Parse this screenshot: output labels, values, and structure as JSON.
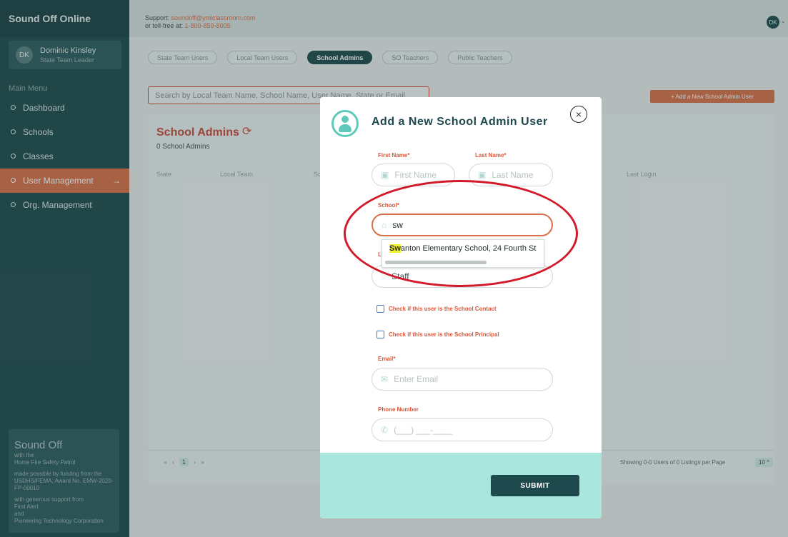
{
  "app": {
    "brand": "Sound Off Online"
  },
  "user": {
    "initials": "DK",
    "name": "Dominic Kinsley",
    "role": "State Team Leader"
  },
  "sidebar": {
    "menu_title": "Main Menu",
    "items": [
      {
        "label": "Dashboard"
      },
      {
        "label": "Schools"
      },
      {
        "label": "Classes"
      },
      {
        "label": "User Management",
        "arrow": "→"
      },
      {
        "label": "Org. Management"
      }
    ],
    "promo": {
      "title": "Sound Off",
      "line1": "with the",
      "line2": "Home Fire Safety Patrol",
      "funding": "made possible by funding from the USDHS/FEMA, Award No. EMW-2020-FP-00010",
      "support": "with generous support from",
      "s1": "First Alert",
      "s2": "and",
      "s3": "Pioneering Technology Corporation"
    }
  },
  "header": {
    "support_prefix": "Support: ",
    "support_email": "soundoff@ymiclassroom.com",
    "tollfree_prefix": "or toll-free at: ",
    "tollfree": "1-800-859-8005",
    "avatar": "DK",
    "caret": "⌄"
  },
  "tabs": [
    {
      "label": "State Team Users"
    },
    {
      "label": "Local Team Users"
    },
    {
      "label": "School Admins"
    },
    {
      "label": "SO Teachers"
    },
    {
      "label": "Public Teachers"
    }
  ],
  "search": {
    "placeholder": "Search by Local Team Name, School Name, User Name, State or Email"
  },
  "add_button": "+ Add a New School Admin User",
  "panel": {
    "title": "School Admins",
    "refresh_icon": "⟳",
    "count": "0 School Admins",
    "columns": {
      "state": "State",
      "local_team": "Local Team",
      "sc": "Sc",
      "last_login": "Last Login"
    },
    "pager": {
      "first": "«",
      "prev": "‹",
      "page": "1",
      "next": "›",
      "last": "»"
    },
    "showing": "Showing 0-0 Users of 0   Listings per Page",
    "per_page": "10 ^"
  },
  "modal": {
    "title": "Add a New School Admin User",
    "close_icon": "×",
    "first_name_label": "First Name*",
    "first_name_placeholder": "First Name",
    "last_name_label": "Last Name*",
    "last_name_placeholder": "Last Name",
    "school_label": "School*",
    "school_value": "sw",
    "dropdown_match": "Sw",
    "dropdown_rest": "anton Elementary School, 24 Fourth St",
    "role_label_fragment": "L",
    "role_value": "Staff",
    "check_contact": "Check if this user is the School Contact",
    "check_principal": "Check if this user is the School Principal",
    "email_label": "Email*",
    "email_placeholder": "Enter Email",
    "phone_label": "Phone Number",
    "phone_placeholder": "(___) ___-____",
    "submit": "SUBMIT"
  }
}
